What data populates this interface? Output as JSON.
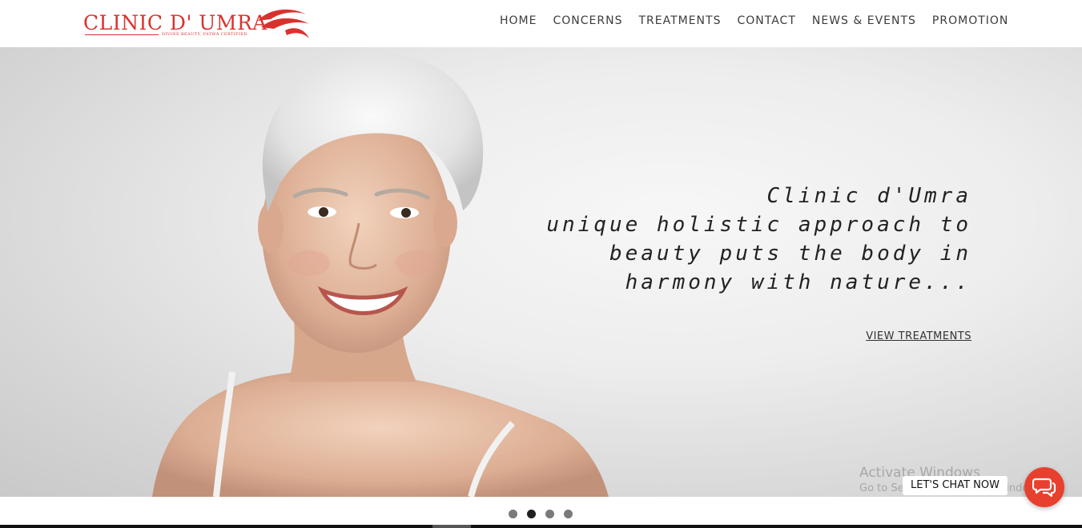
{
  "header": {
    "logo": {
      "name": "CLINIC D' UMRA",
      "tagline": "DIVINE BEAUTY, FATWA CERTIFIED",
      "brand_color": "#d9322e"
    },
    "nav": [
      {
        "label": "HOME"
      },
      {
        "label": "CONCERNS"
      },
      {
        "label": "TREATMENTS"
      },
      {
        "label": "CONTACT"
      },
      {
        "label": "NEWS & EVENTS"
      },
      {
        "label": "PROMOTION"
      }
    ]
  },
  "hero": {
    "lines": [
      "Clinic d'Umra",
      "unique holistic approach to",
      "beauty puts the body in",
      "harmony with nature..."
    ],
    "cta_label": "VIEW TREATMENTS",
    "slider": {
      "slide_count": 4,
      "active_slide": 2
    }
  },
  "overlay": {
    "watermark_title": "Activate Windows",
    "watermark_sub": "Go to Settings to activate Windows."
  },
  "chat": {
    "label": "LET'S CHAT NOW",
    "icon": "chat-bubbles-icon",
    "color": "#e8402f"
  }
}
